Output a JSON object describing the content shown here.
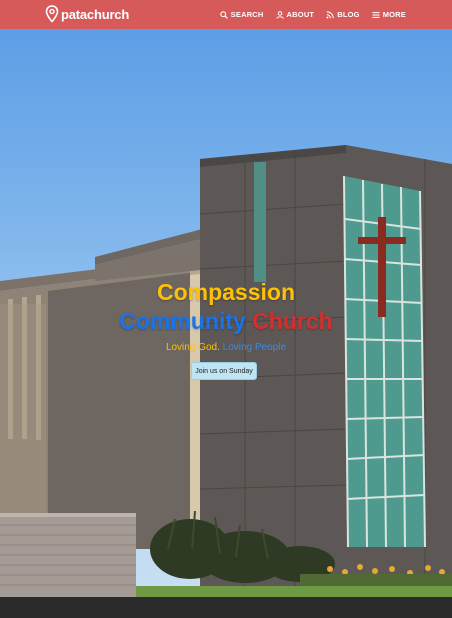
{
  "header": {
    "brand": "patachurch",
    "nav": [
      {
        "label": "SEARCH",
        "icon": "search-icon"
      },
      {
        "label": "ABOUT",
        "icon": "person-icon"
      },
      {
        "label": "BLOG",
        "icon": "rss-icon"
      },
      {
        "label": "MORE",
        "icon": "menu-icon"
      }
    ],
    "color": "#d65a5a"
  },
  "hero": {
    "title_line1": "Compassion",
    "title_word_community": "Community",
    "title_word_church": "Church",
    "tagline_part1": "Loving God.",
    "tagline_part2": "Loving People",
    "cta_label": "Join us on Sunday",
    "colors": {
      "yellow": "#ffc107",
      "blue": "#1a73e8",
      "red": "#d32f2f"
    }
  }
}
